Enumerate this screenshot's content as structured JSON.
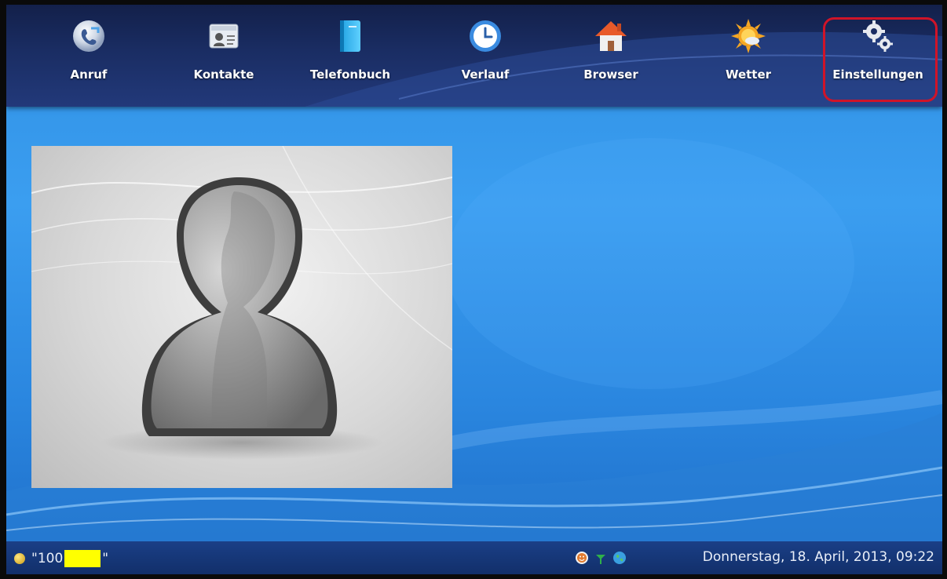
{
  "toolbar": {
    "items": [
      {
        "label": "Anruf",
        "icon": "phone-call-icon"
      },
      {
        "label": "Kontakte",
        "icon": "contacts-card-icon"
      },
      {
        "label": "Telefonbuch",
        "icon": "phonebook-icon"
      },
      {
        "label": "Verlauf",
        "icon": "clock-icon"
      },
      {
        "label": "Browser",
        "icon": "home-icon"
      },
      {
        "label": "Wetter",
        "icon": "weather-sun-icon"
      },
      {
        "label": "Einstellungen",
        "icon": "gears-icon"
      }
    ],
    "highlighted": "Einstellungen",
    "highlight_color": "#d01428"
  },
  "contact": {
    "photo": "default-avatar-silhouette"
  },
  "statusbar": {
    "account_prefix": "\"100",
    "account_suffix": "\"",
    "account_redacted": true,
    "tray_icons": [
      "status-smiley-icon",
      "network-antenna-icon",
      "globe-icon"
    ],
    "datetime": "Donnerstag, 18. April, 2013, 09:22"
  },
  "colors": {
    "background": "#3b9ef0",
    "toolbar": "#1a2d63",
    "statusbar": "#122f6a",
    "redaction": "#ffff00"
  }
}
